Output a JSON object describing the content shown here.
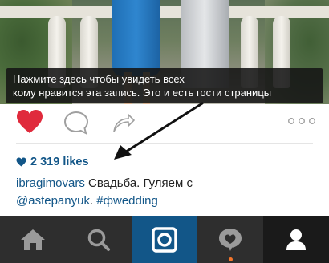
{
  "tooltip": {
    "line1": "Нажмите здесь чтобы увидеть всех",
    "line2": "кому нравится эта запись. Это и есть гости страницы"
  },
  "post": {
    "likes_text": "2 319 likes",
    "caption_user": "ibragimovars",
    "caption_text_1": " Свадьба. Гуляем с",
    "caption_mention": "@astepanyuk",
    "caption_sep": ". ",
    "caption_hashtag": "#фwedding"
  },
  "colors": {
    "like_red": "#e02a3c",
    "link_blue": "#125688",
    "tabbar_bg": "#2e2e2e",
    "camera_tab_bg": "#125688",
    "notification_dot": "#f5752a"
  },
  "tabbar": {
    "items": [
      {
        "icon": "home-icon"
      },
      {
        "icon": "search-icon"
      },
      {
        "icon": "camera-icon"
      },
      {
        "icon": "activity-heart-icon"
      },
      {
        "icon": "profile-icon"
      }
    ]
  }
}
